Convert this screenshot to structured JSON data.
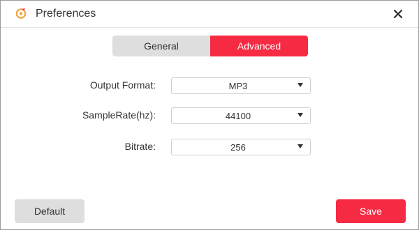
{
  "window": {
    "title": "Preferences",
    "icon": "app-logo-icon",
    "close_icon": "close-icon"
  },
  "tabs": [
    {
      "label": "General",
      "active": false
    },
    {
      "label": "Advanced",
      "active": true
    }
  ],
  "settings": {
    "output_format": {
      "label": "Output Format:",
      "value": "MP3"
    },
    "sample_rate": {
      "label": "SampleRate(hz):",
      "value": "44100"
    },
    "bitrate": {
      "label": "Bitrate:",
      "value": "256"
    }
  },
  "footer": {
    "default_label": "Default",
    "save_label": "Save"
  },
  "colors": {
    "accent": "#f72a43",
    "neutral_button": "#dedede"
  }
}
